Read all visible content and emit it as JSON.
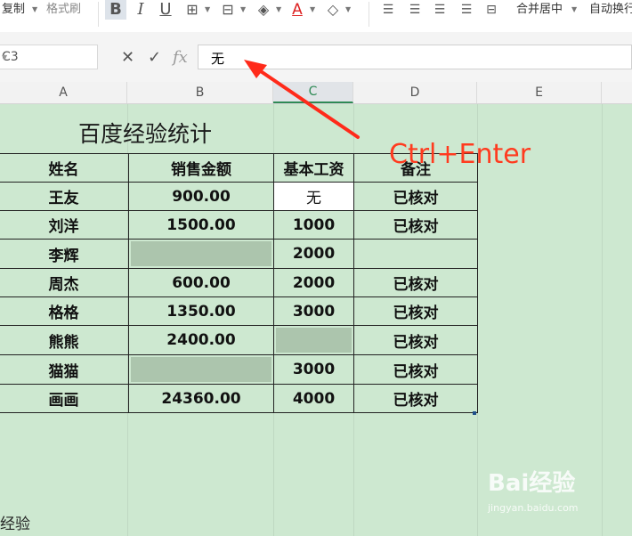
{
  "toolbar": {
    "copy_label": "复制",
    "format_painter_label": "格式刷",
    "merge_center_label": "合并居中",
    "wrap_label": "自动换行"
  },
  "formula_bar": {
    "cell_ref": "C3",
    "formula_value": "无"
  },
  "columns": [
    "A",
    "B",
    "C",
    "D",
    "E"
  ],
  "selected_column": "C",
  "sheet": {
    "title": "百度经验统计",
    "headers": [
      "姓名",
      "销售金额",
      "基本工资",
      "备注"
    ],
    "rows": [
      [
        "王友",
        "900.00",
        "无",
        "已核对"
      ],
      [
        "刘洋",
        "1500.00",
        "1000",
        "已核对"
      ],
      [
        "李辉",
        "",
        "2000",
        ""
      ],
      [
        "周杰",
        "600.00",
        "2000",
        "已核对"
      ],
      [
        "格格",
        "1350.00",
        "3000",
        "已核对"
      ],
      [
        "熊熊",
        "2400.00",
        "",
        "已核对"
      ],
      [
        "猫猫",
        "",
        "3000",
        "已核对"
      ],
      [
        "画画",
        "24360.00",
        "4000",
        "已核对"
      ]
    ],
    "footer_text": "经验"
  },
  "annotation": {
    "text": "Ctrl+Enter",
    "color": "#ff3b1f"
  },
  "watermark": {
    "main": "Bai经验",
    "sub": "jingyan.baidu.com"
  },
  "colors": {
    "sheet_background": "#cde8d0",
    "empty_selected_cell": "#acc5ad",
    "active_cell": "#ffffff"
  }
}
